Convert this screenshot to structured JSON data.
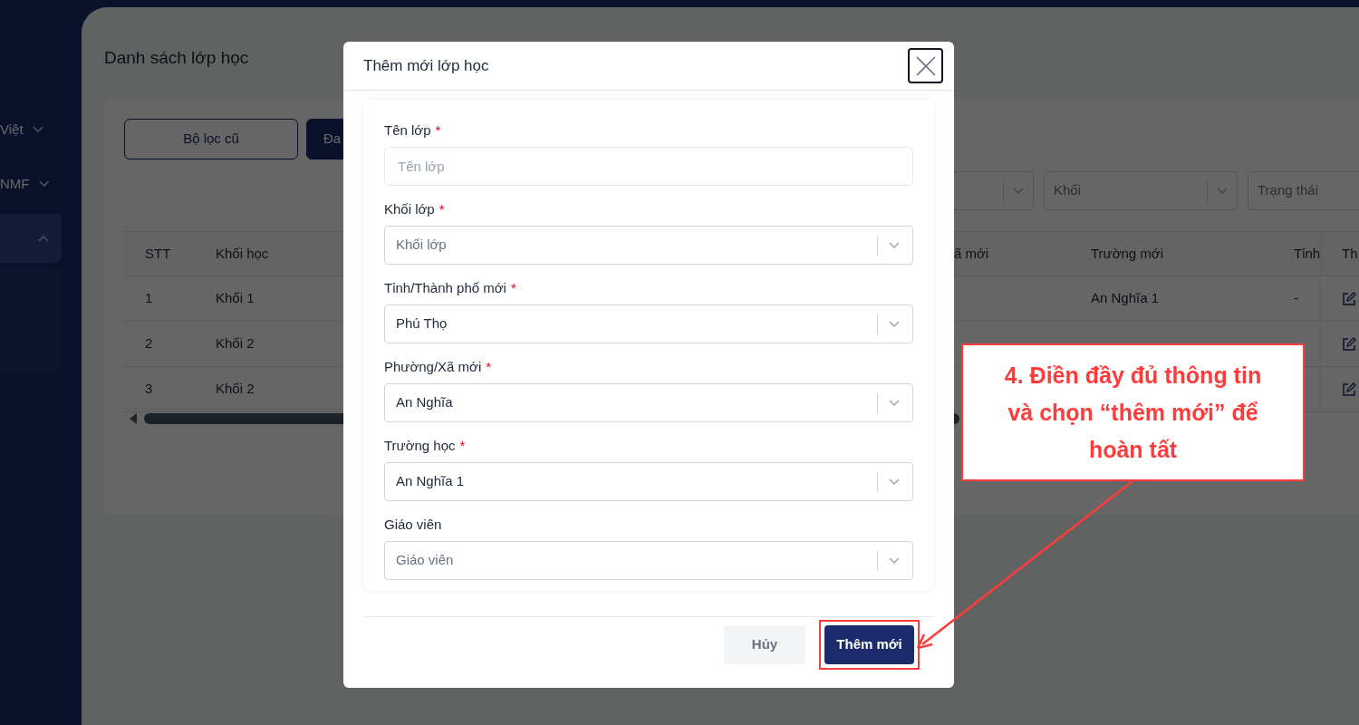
{
  "sidebar": {
    "items": [
      {
        "label": "Việt",
        "expanded": false,
        "selected": false
      },
      {
        "label": "NMF",
        "expanded": false,
        "selected": false
      },
      {
        "expanded": true,
        "selected": true
      }
    ]
  },
  "page": {
    "title": "Danh sách lớp học"
  },
  "filter_buttons": [
    {
      "label": "Bộ lọc cũ",
      "selected": false
    },
    {
      "label": "Đa",
      "selected": true
    }
  ],
  "filters": [
    {
      "kind": "select"
    },
    {
      "kind": "select",
      "placeholder": "Khối"
    },
    {
      "kind": "input",
      "placeholder": "Trạng thái"
    }
  ],
  "table": {
    "columns": [
      "STT",
      "Khối học",
      "ã mới",
      "Trường mới",
      "Tỉnh",
      "Th"
    ],
    "rows": [
      {
        "stt": "1",
        "khoi_hoc": "Khối 1",
        "truong_moi": "An Nghĩa 1",
        "tinh": "-"
      },
      {
        "stt": "2",
        "khoi_hoc": "Khối 2"
      },
      {
        "stt": "3",
        "khoi_hoc": "Khối 2"
      }
    ]
  },
  "modal": {
    "title": "Thêm mới lớp học",
    "fields": [
      {
        "label": "Tên lớp",
        "required_mark": "*",
        "kind": "text",
        "placeholder": "Tên lớp"
      },
      {
        "label": "Khối lớp",
        "required_mark": "*",
        "kind": "select",
        "placeholder": "Khối lớp"
      },
      {
        "label": "Tỉnh/Thành phố mới",
        "required_mark": "*",
        "kind": "select",
        "value": "Phú Thọ"
      },
      {
        "label": "Phường/Xã mới",
        "required_mark": "*",
        "kind": "select",
        "value": "An Nghĩa"
      },
      {
        "label": "Trường học",
        "required_mark": "*",
        "kind": "select",
        "value": "An Nghĩa 1"
      },
      {
        "label": "Giáo viên",
        "kind": "select",
        "placeholder": "Giáo viên"
      }
    ],
    "buttons": [
      {
        "label": "Hủy",
        "kind": "secondary",
        "highlighted": false
      },
      {
        "label": "Thêm mới",
        "kind": "primary",
        "highlighted": true
      }
    ]
  },
  "callout": {
    "text": "4. Điền đầy đủ thông tin và chọn “thêm mới” để hoàn tất"
  }
}
